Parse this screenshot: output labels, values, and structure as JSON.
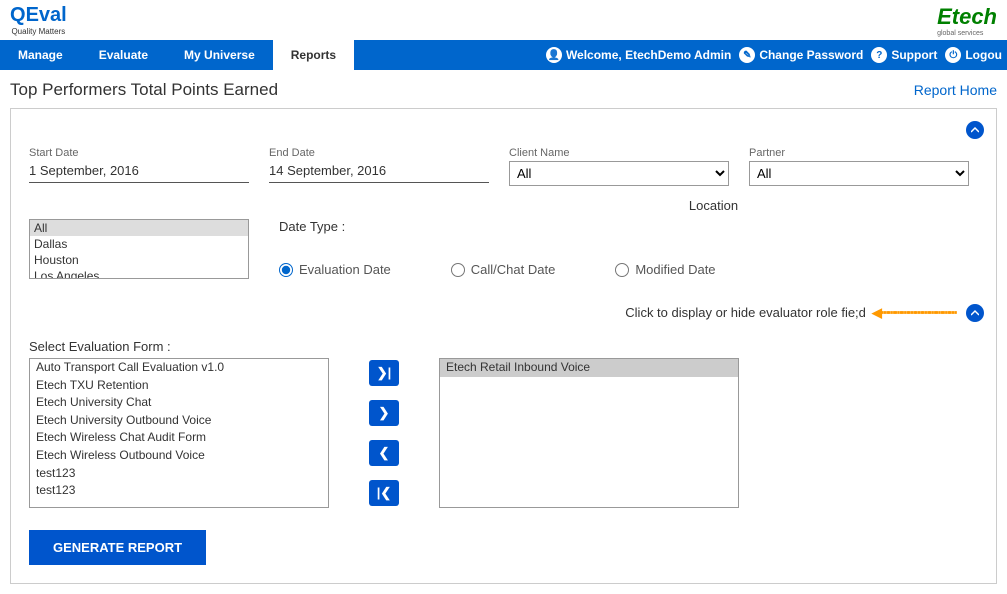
{
  "logo": {
    "tagline": "Quality Matters"
  },
  "nav": {
    "items": [
      "Manage",
      "Evaluate",
      "My Universe",
      "Reports"
    ],
    "active_index": 3,
    "welcome": "Welcome, EtechDemo Admin",
    "change_pw": "Change Password",
    "support": "Support",
    "logout": "Logou"
  },
  "page": {
    "title": "Top Performers Total Points Earned",
    "report_home": "Report Home"
  },
  "filters": {
    "start_date_label": "Start Date",
    "start_date": "1 September, 2016",
    "end_date_label": "End Date",
    "end_date": "14 September, 2016",
    "client_name_label": "Client Name",
    "client_name": "All",
    "partner_label": "Partner",
    "partner": "All",
    "location_label": "Location",
    "locations": [
      "All",
      "Dallas",
      "Houston",
      "Los Angeles"
    ],
    "date_type_label": "Date Type :",
    "date_types": [
      "Evaluation Date",
      "Call/Chat Date",
      "Modified Date"
    ],
    "date_type_selected": 0
  },
  "annotation": {
    "text": "Click to display or hide evaluator role fie;d"
  },
  "eval_form": {
    "label": "Select Evaluation Form :",
    "available": [
      "Auto Transport Call Evaluation v1.0",
      "Etech TXU Retention",
      "Etech University Chat",
      "Etech University Outbound Voice",
      "Etech Wireless Chat Audit Form",
      "Etech Wireless Outbound Voice",
      "test123",
      "test123"
    ],
    "selected": [
      "Etech Retail Inbound Voice"
    ]
  },
  "buttons": {
    "generate": "GENERATE REPORT"
  }
}
